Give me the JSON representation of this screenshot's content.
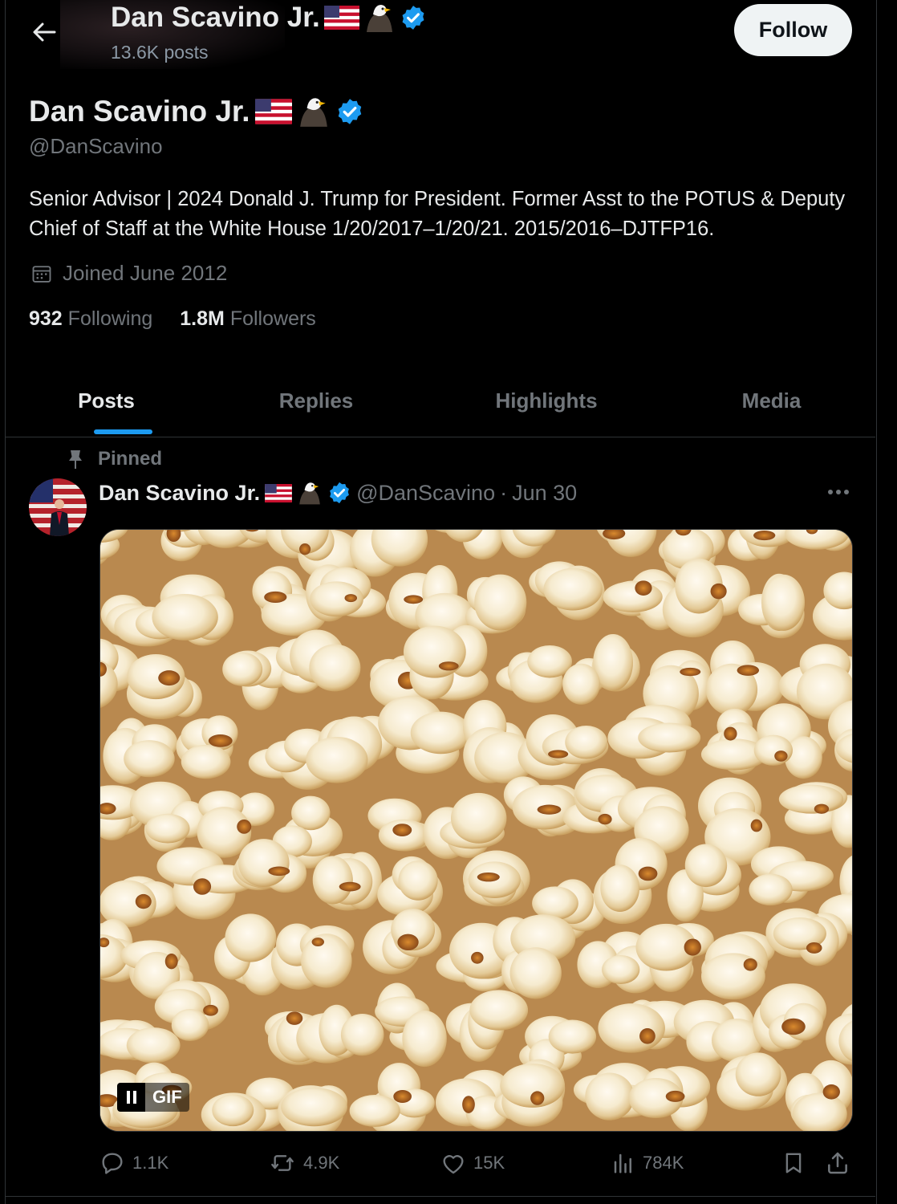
{
  "header": {
    "back_icon": "arrow-left-icon",
    "name": "Dan Scavino Jr.",
    "name_emojis": [
      "flag-usa-icon",
      "eagle-icon"
    ],
    "verified_icon": "verified-badge-icon",
    "posts_count": "13.6K posts",
    "follow_label": "Follow"
  },
  "profile": {
    "name": "Dan Scavino Jr.",
    "handle": "@DanScavino",
    "bio": "Senior Advisor | 2024 Donald J. Trump for President. Former Asst to the POTUS & Deputy Chief of Staff at the White House 1/20/2017–1/20/21. 2015/2016–DJTFP16.",
    "joined": "Joined June 2012",
    "following_count": "932",
    "following_label": "Following",
    "followers_count": "1.8M",
    "followers_label": "Followers"
  },
  "tabs": [
    {
      "label": "Posts",
      "active": true
    },
    {
      "label": "Replies",
      "active": false
    },
    {
      "label": "Highlights",
      "active": false
    },
    {
      "label": "Media",
      "active": false
    }
  ],
  "post": {
    "pinned_label": "Pinned",
    "author_name": "Dan Scavino Jr.",
    "author_handle": "@DanScavino",
    "separator": "·",
    "date": "Jun 30",
    "media_type": "GIF",
    "media_subject": "popcorn",
    "actions": {
      "replies": "1.1K",
      "reposts": "4.9K",
      "likes": "15K",
      "views": "784K"
    }
  },
  "colors": {
    "background": "#000000",
    "text_primary": "#e7e9ea",
    "text_secondary": "#71767b",
    "accent": "#1d9bf0",
    "border": "#2f3336",
    "follow_button_bg": "#eff3f4"
  }
}
